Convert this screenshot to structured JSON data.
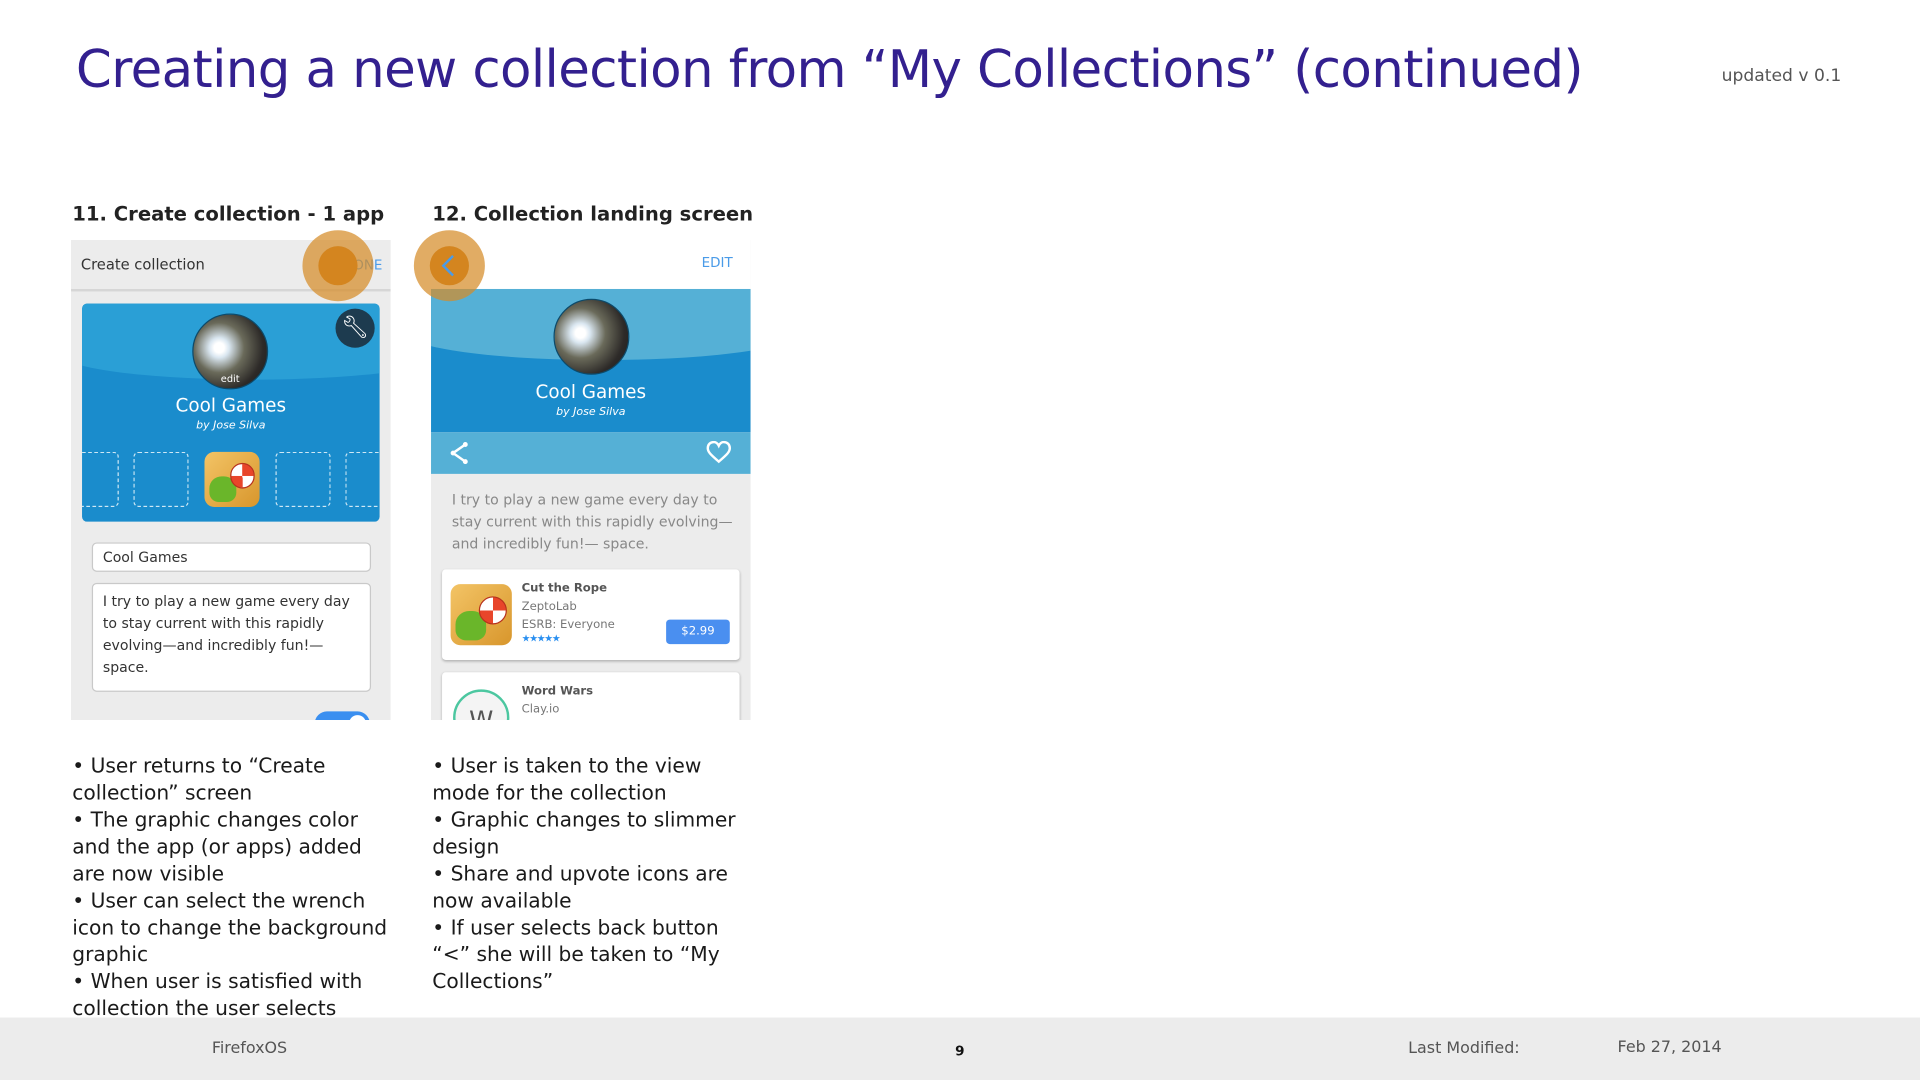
{
  "slide": {
    "title": "Creating a new collection from “My Collections” (continued)",
    "version": "updated v 0.1"
  },
  "step11": {
    "heading": "11. Create collection - 1 app",
    "header_title": "Create collection",
    "done_label": "DONE",
    "collection_name": "Cool Games",
    "byline": "by Jose Silva",
    "avatar_edit_label": "edit",
    "name_input_value": "Cool Games",
    "description_value": "I try to play a new game every day to stay current with this rapidly evolving—and incredibly fun!— space.",
    "bullets": [
      "• User returns to “Create collection” screen",
      "• The graphic changes color and the app (or apps) added are now visible",
      "• User can select the wrench icon to change the background graphic",
      "• When user is satisfied with collection the user selects “DONE”"
    ]
  },
  "step12": {
    "heading": "12. Collection landing screen",
    "edit_label": "EDIT",
    "collection_name": "Cool Games",
    "byline": "by Jose Silva",
    "description": "I try to play a new game every day to stay current with this rapidly evolving—and incredibly fun!— space.",
    "apps": [
      {
        "name": "Cut the Rope",
        "developer": "ZeptoLab",
        "rating_label": "ESRB: Everyone",
        "stars": 5,
        "price": "$2.99"
      },
      {
        "name": "Word Wars",
        "developer": "Clay.io",
        "icon_letter": "W"
      }
    ],
    "bullets": [
      "• User is taken to the view mode for the collection",
      "• Graphic changes to slimmer design",
      "• Share and upvote icons are now available",
      "• If user selects back button “<” she will be taken to “My Collections”"
    ]
  },
  "footer": {
    "product": "FirefoxOS",
    "page_number": "9",
    "last_modified_label": "Last Modified:",
    "last_modified_date": "Feb 27, 2014"
  },
  "colors": {
    "title": "#33208f",
    "accent_blue": "#4a9be8",
    "banner": "#1a8ccc",
    "highlight": "#d4851f"
  }
}
